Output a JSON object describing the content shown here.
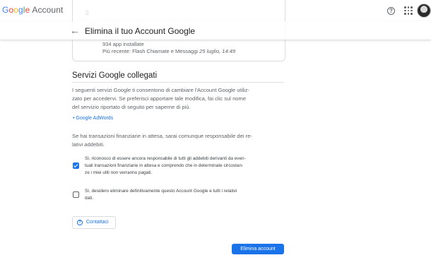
{
  "app": {
    "logo_word": "Google",
    "logo_suffix": "Account"
  },
  "header": {
    "title": "Elimina il tuo Account Google"
  },
  "card": {
    "apps_installed": "934 app installate",
    "recent_prefix": "Più recente: Flash Chiamate e Messaggi",
    "recent_date": "25 luglio, 14:49"
  },
  "section": {
    "title": "Servizi Google collegati",
    "intro_lines": [
      "I seguenti servizi Google ti consentono di cambiare l'Account Google utiliz-",
      "zato per accedervi. Se preferisci apportare tale modifica, fai clic sul nome",
      "del servizio riportato di seguito per saperne di più."
    ],
    "service_link": "Google AdWords",
    "financial_lines": [
      "Se hai transazioni finanziarie in attesa, sarai comunque responsabile dei re-",
      "lativi addebiti."
    ]
  },
  "checkboxes": [
    {
      "checked": true,
      "lines": [
        "Sì, riconosco di essere ancora responsabile di tutti gli addebiti derivanti da even-",
        "tuali transazioni finanziarie in attesa e comprendo che in determinate circostan-",
        "ze i miei utili non verranno pagati."
      ]
    },
    {
      "checked": false,
      "lines": [
        "Sì, desidero eliminare definitivamente questo Account Google e tutti i relativi",
        "dati."
      ]
    }
  ],
  "buttons": {
    "contact": "Contattaci",
    "delete": "Elimina account"
  },
  "colors": {
    "accent": "#1a73e8",
    "text_secondary": "#5f6368"
  }
}
